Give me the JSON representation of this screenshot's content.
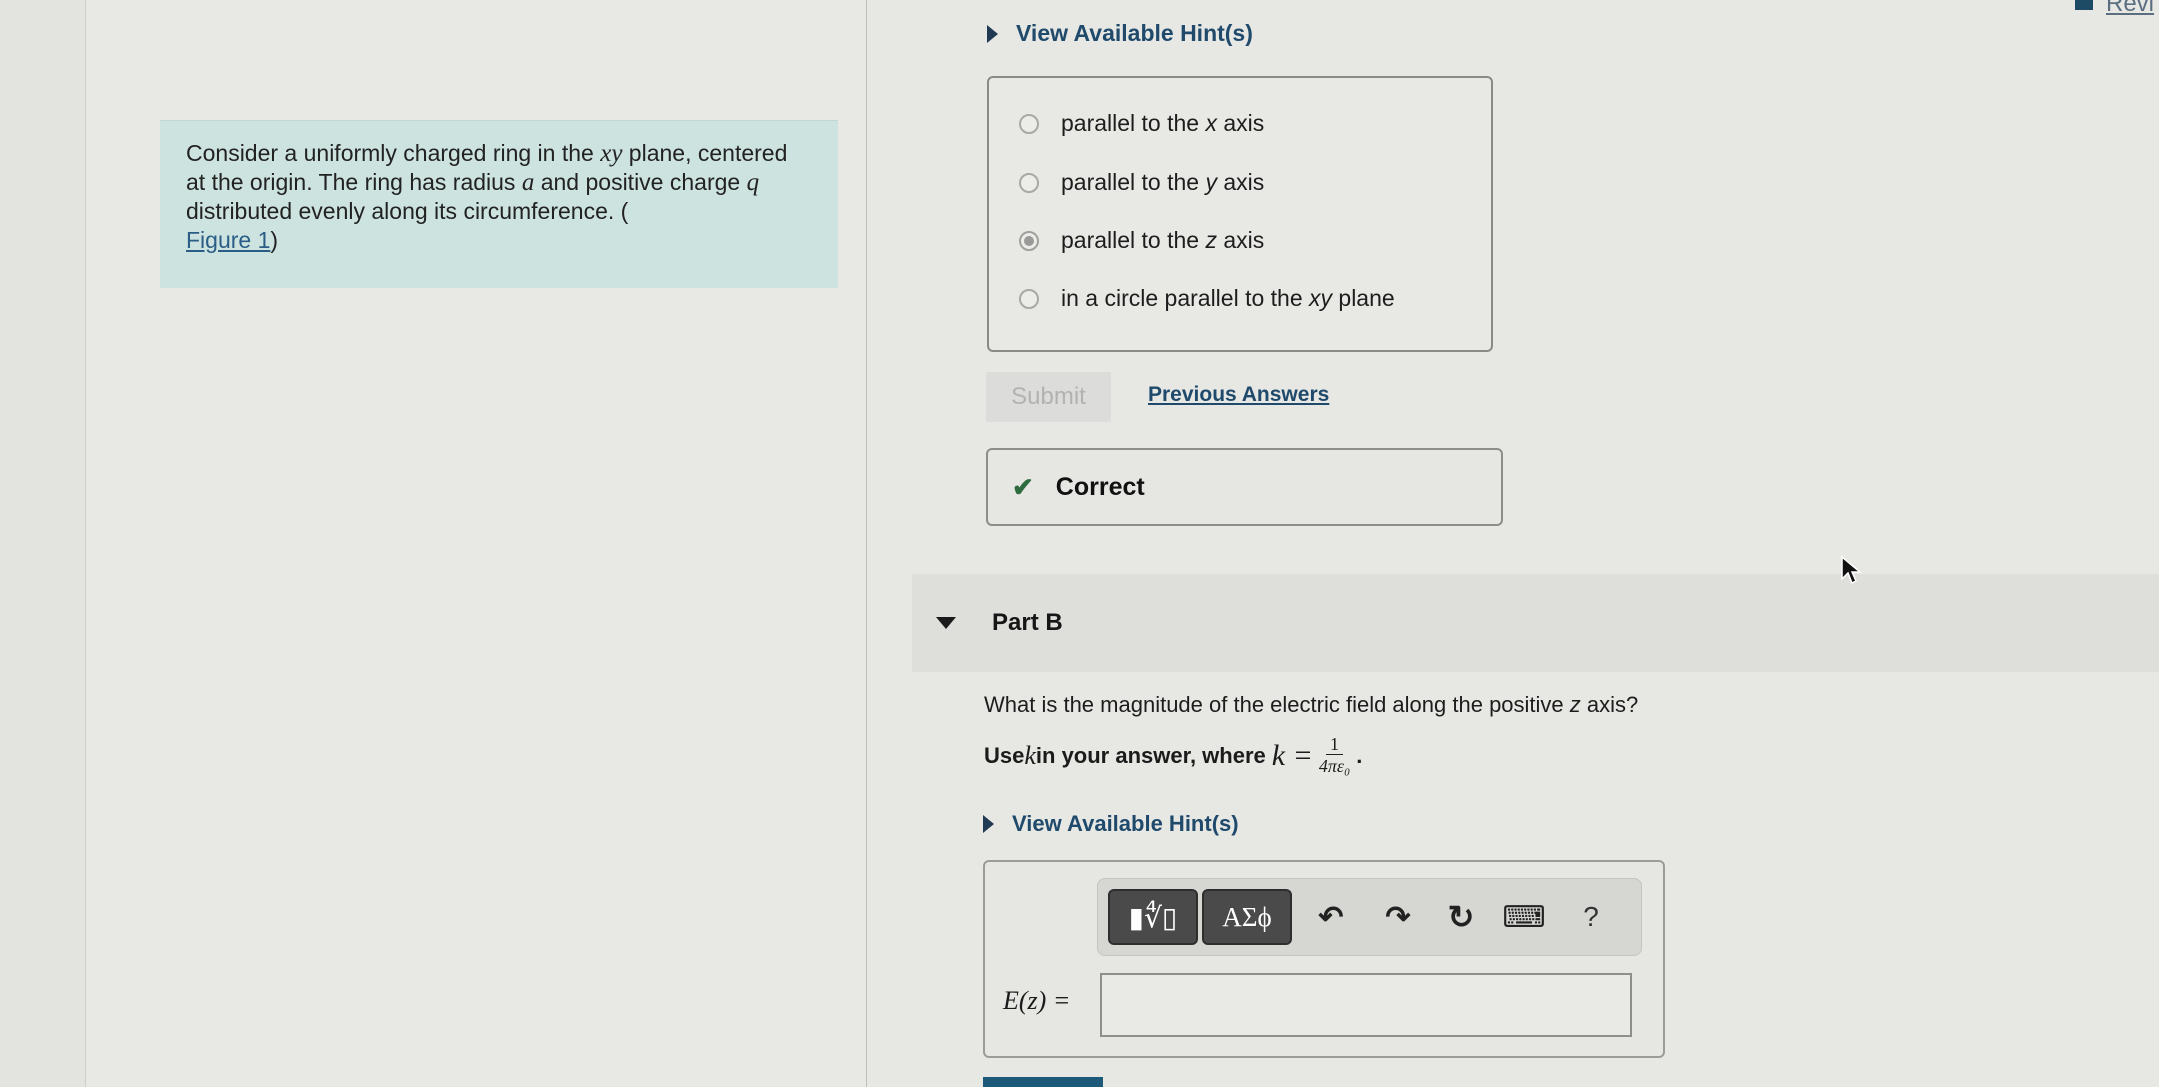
{
  "intro": {
    "text_before_xy": "Consider a uniformly charged ring in the ",
    "xy": "xy",
    "text_after_xy": " plane, centered at the origin. The ring has radius ",
    "a": "a",
    "text_after_a": " and positive charge ",
    "q": "q",
    "text_after_q": " distributed evenly along its circumference. (",
    "figure_link": "Figure 1",
    "close": ")"
  },
  "part_a": {
    "hint_label": "View Available Hint(s)",
    "choices": [
      {
        "pre": "parallel to the ",
        "var": "x",
        "post": " axis",
        "selected": false
      },
      {
        "pre": "parallel to the ",
        "var": "y",
        "post": " axis",
        "selected": false
      },
      {
        "pre": "parallel to the ",
        "var": "z",
        "post": " axis",
        "selected": true
      },
      {
        "pre": "in a circle parallel to the ",
        "var": "xy",
        "post": " plane",
        "selected": false
      }
    ],
    "submit_label": "Submit",
    "previous_answers_label": "Previous Answers",
    "feedback": {
      "icon": "check-icon",
      "label": "Correct",
      "color": "#2e6b3e"
    }
  },
  "part_b": {
    "title": "Part B",
    "question_pre": "What is the magnitude of the electric field along the positive ",
    "question_var": "z",
    "question_post": " axis?",
    "use_k_pre": "Use ",
    "use_k_var": "k",
    "use_k_mid": " in your answer, where ",
    "use_k_eq": "k =",
    "frac_num": "1",
    "frac_den": "4πε₀",
    "use_k_end": ".",
    "hint_label": "View Available Hint(s)",
    "toolbar": {
      "templates_label": "▮∜▯",
      "greek_label": "ΑΣϕ",
      "undo": "↶",
      "redo": "↷",
      "reset": "↻",
      "keyboard": "⌨",
      "help": "?"
    },
    "answer_label": "E(z) =",
    "answer_value": ""
  },
  "header": {
    "review_label": "Revi"
  },
  "colors": {
    "accent_link": "#1f4a6b",
    "intro_bg": "#cde3df",
    "correct": "#2e6b3e"
  }
}
